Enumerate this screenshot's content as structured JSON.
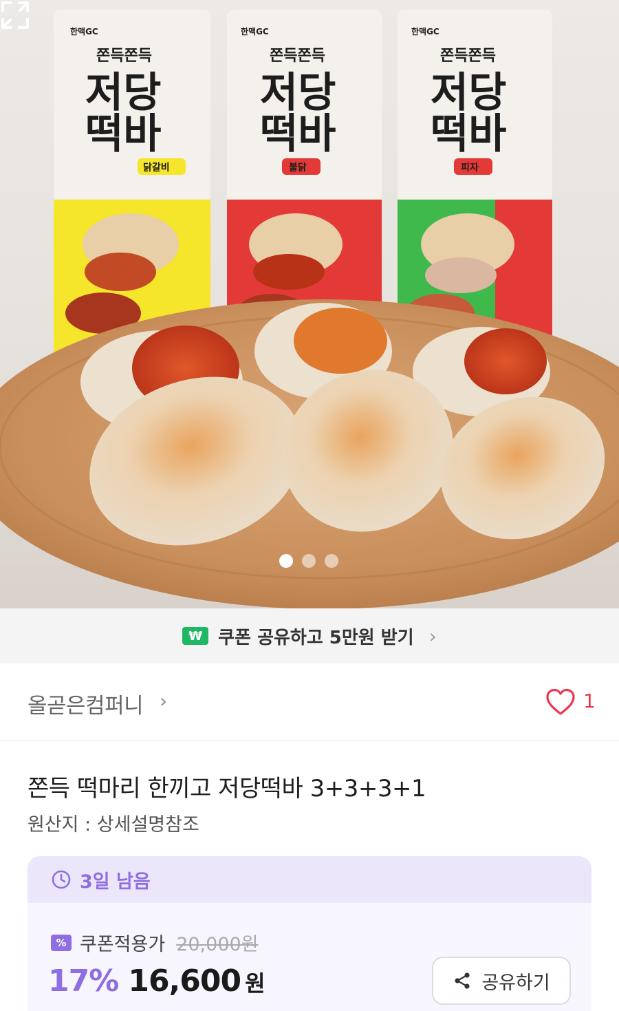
{
  "hero": {
    "packages": [
      {
        "brand": "한맥GC",
        "tagline": "쫀득쫀득",
        "name1": "저당",
        "name2": "떡바",
        "flavor": "닭갈비",
        "accent": "#f5e52b"
      },
      {
        "brand": "한맥GC",
        "tagline": "쫀득쫀득",
        "name1": "저당",
        "name2": "떡바",
        "flavor": "불닭",
        "accent": "#e33a37"
      },
      {
        "brand": "한맥GC",
        "tagline": "쫀득쫀득",
        "name1": "저당",
        "name2": "떡바",
        "flavor": "피자",
        "accent": "#3fb84c"
      }
    ],
    "carousel": {
      "count": 3,
      "active_index": 0
    }
  },
  "coupon_banner": {
    "icon": "won-icon",
    "icon_glyph": "₩",
    "text": "쿠폰 공유하고 5만원 받기"
  },
  "seller": {
    "name": "올곧은컴퍼니",
    "like_count": "1"
  },
  "product": {
    "title": "쫀득 떡마리 한끼고 저당떡바 3+3+3+1",
    "origin": "원산지 : 상세설명참조"
  },
  "price": {
    "time_left": "3일 남음",
    "coupon_badge": "%",
    "coupon_label": "쿠폰적용가",
    "original_price": "20,000원",
    "discount_rate": "17%",
    "final_price": "16,600",
    "currency_unit": "원",
    "share_label": "공유하기"
  },
  "colors": {
    "accent_purple": "#8e6ee0",
    "like_red": "#e8384f",
    "coupon_green": "#1fb763"
  }
}
